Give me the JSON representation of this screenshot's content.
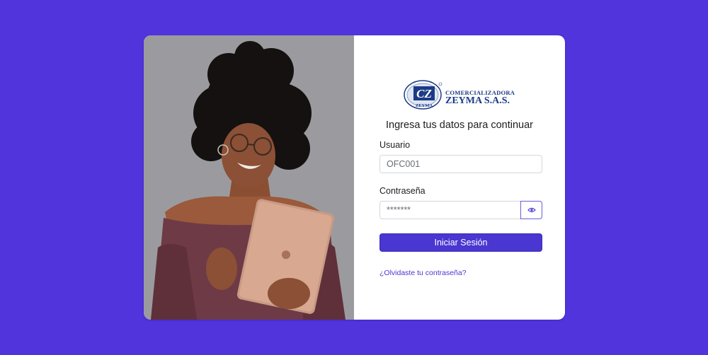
{
  "brand": {
    "logo_initials": "CZ",
    "logo_ring": "ZEYMA",
    "line1": "COMERCIALIZADORA",
    "line2": "ZEYMA S.A.S."
  },
  "form": {
    "subtitle": "Ingresa tus datos para continuar",
    "username_label": "Usuario",
    "username_value": "OFC001",
    "password_label": "Contraseña",
    "password_value": "*******",
    "submit_label": "Iniciar Sesión",
    "forgot_label": "¿Olvidaste tu contraseña?"
  },
  "colors": {
    "background": "#5134dc",
    "accent": "#4a36d0",
    "brand": "#1b3a86"
  }
}
